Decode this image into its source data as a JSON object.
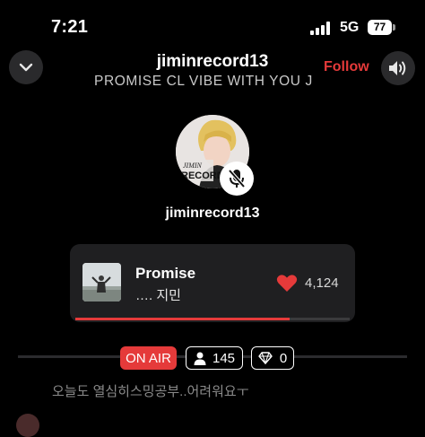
{
  "status_bar": {
    "time": "7:21",
    "network": "5G",
    "battery": "77"
  },
  "header": {
    "host_name": "jiminrecord13",
    "room_title": "PROMISE CL VIBE WITH YOU JIMIN",
    "follow_label": "Follow"
  },
  "avatar": {
    "logo_text_1": "JIMIN",
    "logo_text_2": "RECORD",
    "name": "jiminrecord13"
  },
  "now_playing": {
    "title": "Promise",
    "artist": "…. 지민",
    "likes": "4,124",
    "progress": 0.78
  },
  "room_stats": {
    "on_air_label": "ON AIR",
    "listeners": "145",
    "gems": "0"
  },
  "chat": {
    "message": "오늘도 열심히스밍공부..어려워요ㅜ"
  },
  "colors": {
    "accent": "#e53a3a",
    "card": "#1f1f21",
    "background": "#000000"
  },
  "icons": [
    "chevron-down-icon",
    "speaker-icon",
    "mic-off-icon",
    "heart-icon",
    "person-icon",
    "diamond-icon"
  ]
}
